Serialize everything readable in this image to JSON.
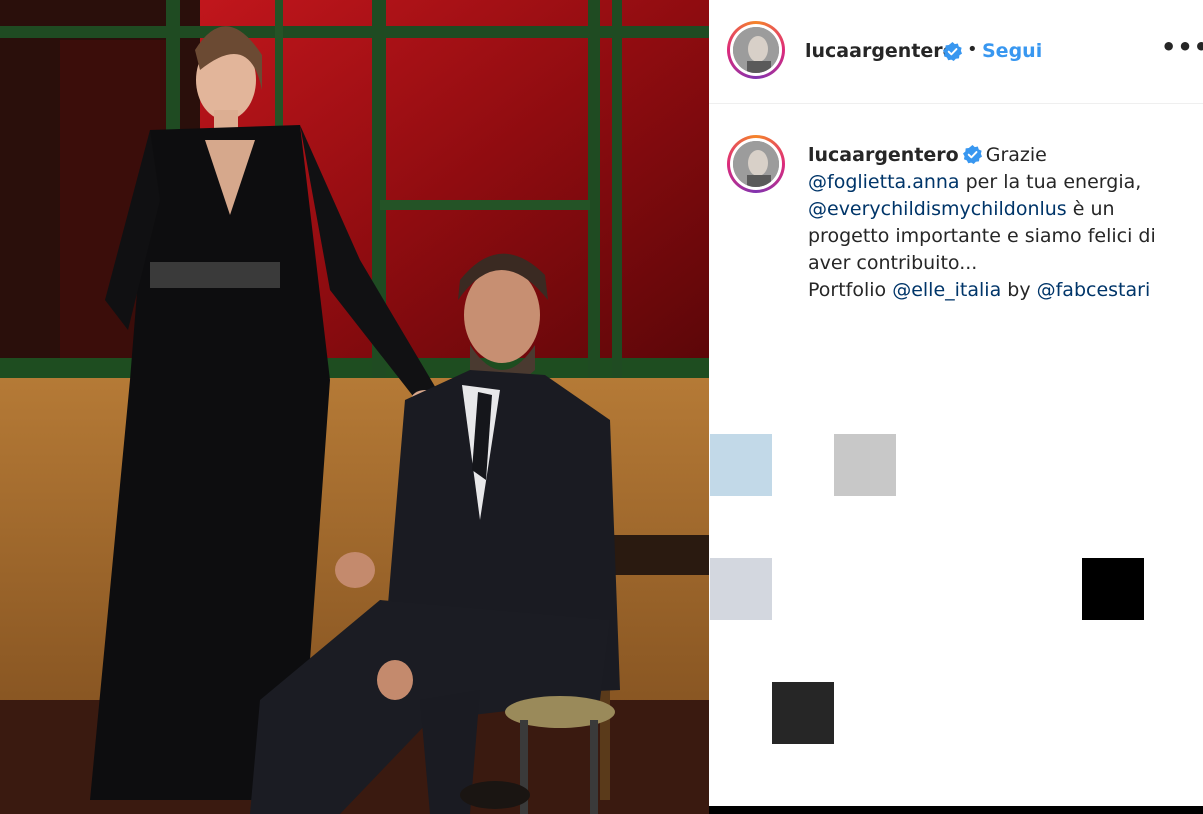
{
  "photo": {
    "alt_subject": "post-photo"
  },
  "header": {
    "username": "lucaargentero",
    "verified_icon": "verified-badge-icon",
    "separator": "•",
    "follow_label": "Segui",
    "more_label": "•••"
  },
  "caption": {
    "username": "lucaargentero",
    "text_1": "Grazie",
    "mention_1": "@foglietta.anna",
    "text_2": " per la tua energia,",
    "mention_2": "@everychildismychildonlus",
    "text_3": " è un progetto importante e siamo felici di aver contribuito...",
    "text_4": "Portfolio ",
    "mention_3": "@elle_italia",
    "text_5": " by ",
    "mention_4": "@fabcestari"
  },
  "placeholders": {
    "colors": [
      "#c2d9e8",
      "#c8c8c8",
      "#d3d7df",
      "#000000",
      "#262626"
    ]
  },
  "colors": {
    "accent": "#3897f0",
    "link": "#003569",
    "verified": "#3897f0"
  }
}
